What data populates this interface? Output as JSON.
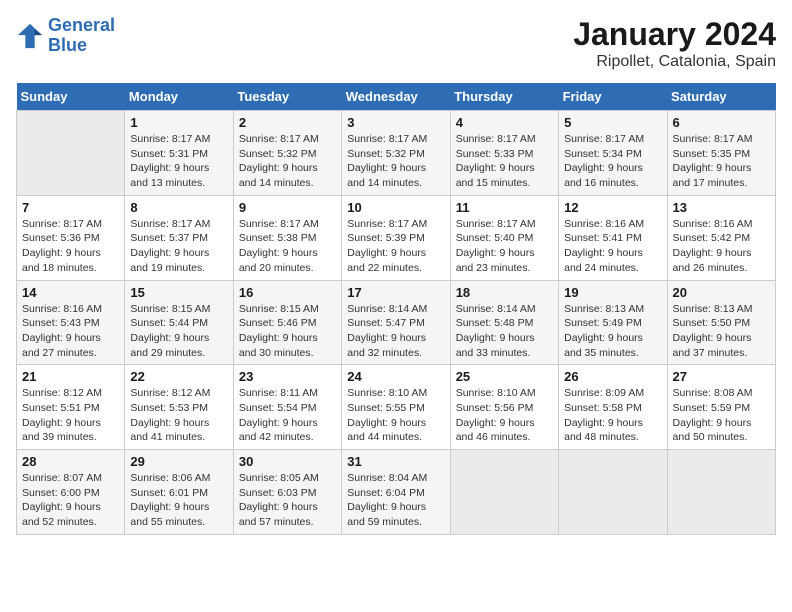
{
  "header": {
    "logo_line1": "General",
    "logo_line2": "Blue",
    "title": "January 2024",
    "subtitle": "Ripollet, Catalonia, Spain"
  },
  "weekdays": [
    "Sunday",
    "Monday",
    "Tuesday",
    "Wednesday",
    "Thursday",
    "Friday",
    "Saturday"
  ],
  "weeks": [
    [
      {
        "day": "",
        "empty": true
      },
      {
        "day": "1",
        "sunrise": "Sunrise: 8:17 AM",
        "sunset": "Sunset: 5:31 PM",
        "daylight": "Daylight: 9 hours and 13 minutes."
      },
      {
        "day": "2",
        "sunrise": "Sunrise: 8:17 AM",
        "sunset": "Sunset: 5:32 PM",
        "daylight": "Daylight: 9 hours and 14 minutes."
      },
      {
        "day": "3",
        "sunrise": "Sunrise: 8:17 AM",
        "sunset": "Sunset: 5:32 PM",
        "daylight": "Daylight: 9 hours and 14 minutes."
      },
      {
        "day": "4",
        "sunrise": "Sunrise: 8:17 AM",
        "sunset": "Sunset: 5:33 PM",
        "daylight": "Daylight: 9 hours and 15 minutes."
      },
      {
        "day": "5",
        "sunrise": "Sunrise: 8:17 AM",
        "sunset": "Sunset: 5:34 PM",
        "daylight": "Daylight: 9 hours and 16 minutes."
      },
      {
        "day": "6",
        "sunrise": "Sunrise: 8:17 AM",
        "sunset": "Sunset: 5:35 PM",
        "daylight": "Daylight: 9 hours and 17 minutes."
      }
    ],
    [
      {
        "day": "7",
        "sunrise": "Sunrise: 8:17 AM",
        "sunset": "Sunset: 5:36 PM",
        "daylight": "Daylight: 9 hours and 18 minutes."
      },
      {
        "day": "8",
        "sunrise": "Sunrise: 8:17 AM",
        "sunset": "Sunset: 5:37 PM",
        "daylight": "Daylight: 9 hours and 19 minutes."
      },
      {
        "day": "9",
        "sunrise": "Sunrise: 8:17 AM",
        "sunset": "Sunset: 5:38 PM",
        "daylight": "Daylight: 9 hours and 20 minutes."
      },
      {
        "day": "10",
        "sunrise": "Sunrise: 8:17 AM",
        "sunset": "Sunset: 5:39 PM",
        "daylight": "Daylight: 9 hours and 22 minutes."
      },
      {
        "day": "11",
        "sunrise": "Sunrise: 8:17 AM",
        "sunset": "Sunset: 5:40 PM",
        "daylight": "Daylight: 9 hours and 23 minutes."
      },
      {
        "day": "12",
        "sunrise": "Sunrise: 8:16 AM",
        "sunset": "Sunset: 5:41 PM",
        "daylight": "Daylight: 9 hours and 24 minutes."
      },
      {
        "day": "13",
        "sunrise": "Sunrise: 8:16 AM",
        "sunset": "Sunset: 5:42 PM",
        "daylight": "Daylight: 9 hours and 26 minutes."
      }
    ],
    [
      {
        "day": "14",
        "sunrise": "Sunrise: 8:16 AM",
        "sunset": "Sunset: 5:43 PM",
        "daylight": "Daylight: 9 hours and 27 minutes."
      },
      {
        "day": "15",
        "sunrise": "Sunrise: 8:15 AM",
        "sunset": "Sunset: 5:44 PM",
        "daylight": "Daylight: 9 hours and 29 minutes."
      },
      {
        "day": "16",
        "sunrise": "Sunrise: 8:15 AM",
        "sunset": "Sunset: 5:46 PM",
        "daylight": "Daylight: 9 hours and 30 minutes."
      },
      {
        "day": "17",
        "sunrise": "Sunrise: 8:14 AM",
        "sunset": "Sunset: 5:47 PM",
        "daylight": "Daylight: 9 hours and 32 minutes."
      },
      {
        "day": "18",
        "sunrise": "Sunrise: 8:14 AM",
        "sunset": "Sunset: 5:48 PM",
        "daylight": "Daylight: 9 hours and 33 minutes."
      },
      {
        "day": "19",
        "sunrise": "Sunrise: 8:13 AM",
        "sunset": "Sunset: 5:49 PM",
        "daylight": "Daylight: 9 hours and 35 minutes."
      },
      {
        "day": "20",
        "sunrise": "Sunrise: 8:13 AM",
        "sunset": "Sunset: 5:50 PM",
        "daylight": "Daylight: 9 hours and 37 minutes."
      }
    ],
    [
      {
        "day": "21",
        "sunrise": "Sunrise: 8:12 AM",
        "sunset": "Sunset: 5:51 PM",
        "daylight": "Daylight: 9 hours and 39 minutes."
      },
      {
        "day": "22",
        "sunrise": "Sunrise: 8:12 AM",
        "sunset": "Sunset: 5:53 PM",
        "daylight": "Daylight: 9 hours and 41 minutes."
      },
      {
        "day": "23",
        "sunrise": "Sunrise: 8:11 AM",
        "sunset": "Sunset: 5:54 PM",
        "daylight": "Daylight: 9 hours and 42 minutes."
      },
      {
        "day": "24",
        "sunrise": "Sunrise: 8:10 AM",
        "sunset": "Sunset: 5:55 PM",
        "daylight": "Daylight: 9 hours and 44 minutes."
      },
      {
        "day": "25",
        "sunrise": "Sunrise: 8:10 AM",
        "sunset": "Sunset: 5:56 PM",
        "daylight": "Daylight: 9 hours and 46 minutes."
      },
      {
        "day": "26",
        "sunrise": "Sunrise: 8:09 AM",
        "sunset": "Sunset: 5:58 PM",
        "daylight": "Daylight: 9 hours and 48 minutes."
      },
      {
        "day": "27",
        "sunrise": "Sunrise: 8:08 AM",
        "sunset": "Sunset: 5:59 PM",
        "daylight": "Daylight: 9 hours and 50 minutes."
      }
    ],
    [
      {
        "day": "28",
        "sunrise": "Sunrise: 8:07 AM",
        "sunset": "Sunset: 6:00 PM",
        "daylight": "Daylight: 9 hours and 52 minutes."
      },
      {
        "day": "29",
        "sunrise": "Sunrise: 8:06 AM",
        "sunset": "Sunset: 6:01 PM",
        "daylight": "Daylight: 9 hours and 55 minutes."
      },
      {
        "day": "30",
        "sunrise": "Sunrise: 8:05 AM",
        "sunset": "Sunset: 6:03 PM",
        "daylight": "Daylight: 9 hours and 57 minutes."
      },
      {
        "day": "31",
        "sunrise": "Sunrise: 8:04 AM",
        "sunset": "Sunset: 6:04 PM",
        "daylight": "Daylight: 9 hours and 59 minutes."
      },
      {
        "day": "",
        "empty": true
      },
      {
        "day": "",
        "empty": true
      },
      {
        "day": "",
        "empty": true
      }
    ]
  ]
}
